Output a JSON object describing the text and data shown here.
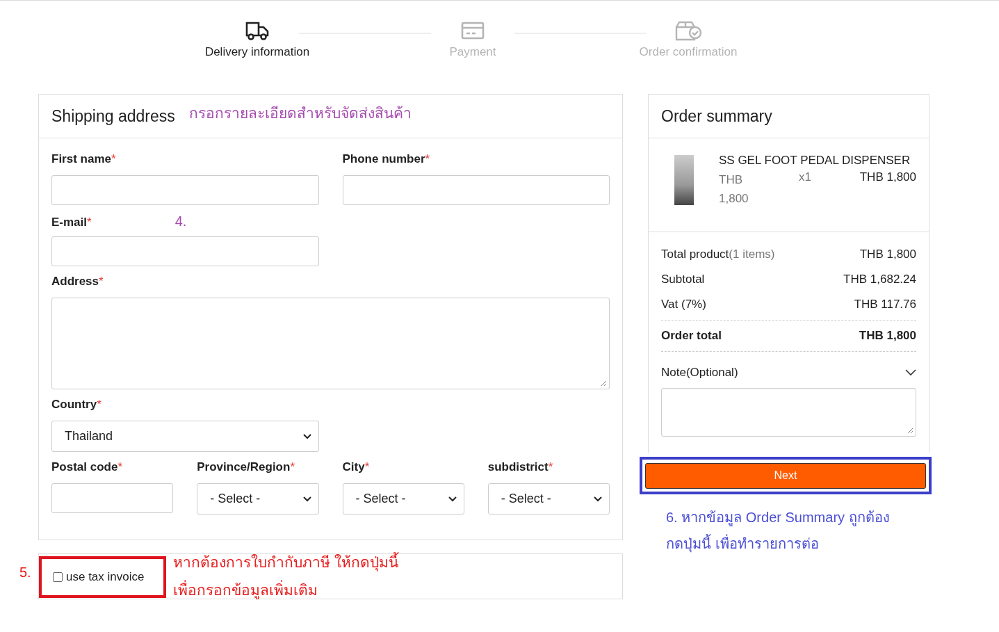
{
  "steps": [
    {
      "kind": "truck",
      "label": "Delivery information",
      "selected": true
    },
    {
      "kind": "card",
      "label": "Payment",
      "selected": false
    },
    {
      "kind": "box",
      "label": "Order confirmation",
      "selected": false
    }
  ],
  "shipping": {
    "title": "Shipping address",
    "note": "กรอกรายละเอียดสำหรับจัดส่งสินค้า",
    "rows": [
      {
        "fields": [
          {
            "kind": "text",
            "label": "First name",
            "mark": "*"
          },
          {
            "kind": "text",
            "label": "Phone number",
            "mark": "*"
          }
        ]
      },
      {
        "fields": [
          {
            "kind": "text",
            "label": "E-mail",
            "mark": "*",
            "note": "4."
          }
        ]
      },
      {
        "fields": [
          {
            "kind": "textarea",
            "label": "Address",
            "mark": "*"
          }
        ]
      },
      {
        "fields": [
          {
            "kind": "select",
            "label": "Country",
            "mark": "*",
            "value": "Thailand"
          }
        ]
      },
      {
        "fields": [
          {
            "kind": "text",
            "label": "Postal code",
            "mark": "*"
          },
          {
            "kind": "select",
            "label": "Province/Region",
            "mark": "*",
            "value": "- Select -"
          },
          {
            "kind": "select",
            "label": "City",
            "mark": "*",
            "value": "- Select -"
          },
          {
            "kind": "select",
            "label": "subdistrict",
            "mark": "*",
            "value": "- Select -"
          }
        ]
      }
    ]
  },
  "tax": {
    "number": "5.",
    "label": "use tax invoice",
    "checked": false,
    "note": "หากต้องการใบกำกับภาษี ให้กดปุ่มนี้ เพื่อกรอกข้อมูลเพิ่มเติม"
  },
  "summary": {
    "title": "Order summary",
    "item": {
      "name": "SS GEL FOOT PEDAL DISPENSER",
      "price": "THB 1,800",
      "qty": "x1",
      "total": "THB 1,800"
    },
    "totals": [
      {
        "kind": "normal",
        "label": "Total product",
        "detail": "(1 items)",
        "value": "THB 1,800"
      },
      {
        "kind": "normal",
        "label": "Subtotal",
        "value": "THB 1,682.24"
      },
      {
        "kind": "normal",
        "label": "Vat (7%)",
        "value": "THB 117.76"
      },
      {
        "kind": "grand",
        "label": "Order total",
        "value": "THB 1,800"
      }
    ],
    "note_label": "Note(Optional)",
    "button": "Next",
    "annotation": "6. หากข้อมูล Order Summary ถูกต้อง กดปุ่มนี้ เพื่อทำรายการต่อ"
  }
}
